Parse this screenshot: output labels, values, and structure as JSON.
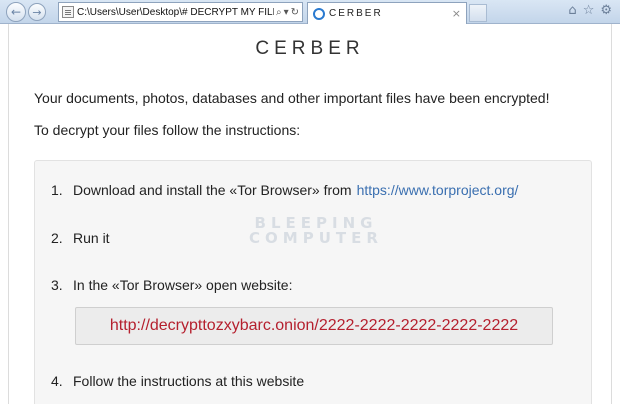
{
  "browser": {
    "address": "C:\\Users\\User\\Desktop\\# DECRYPT MY FILES",
    "search_icon": "search-icon",
    "tab_title": "CERBER",
    "tab_close": "×"
  },
  "page": {
    "title": "CERBER",
    "lead_1": "Your documents, photos, databases and other important files have been encrypted!",
    "lead_2": "To decrypt your files follow the instructions:",
    "steps": [
      {
        "num": "1.",
        "text": "Download and install the «Tor Browser» from",
        "link": "https://www.torproject.org/"
      },
      {
        "num": "2.",
        "text": "Run it"
      },
      {
        "num": "3.",
        "text": "In the «Tor Browser» open website:"
      },
      {
        "num": "4.",
        "text": "Follow the instructions at this website"
      }
    ],
    "decrypt_url": "http://decrypttozxybarc.onion/2222-2222-2222-2222-2222"
  },
  "watermark": {
    "line_1": "BLEEPING",
    "line_2": "COMPUTER"
  },
  "colors": {
    "link": "#3a6fb0",
    "url_text": "#b5202e"
  }
}
